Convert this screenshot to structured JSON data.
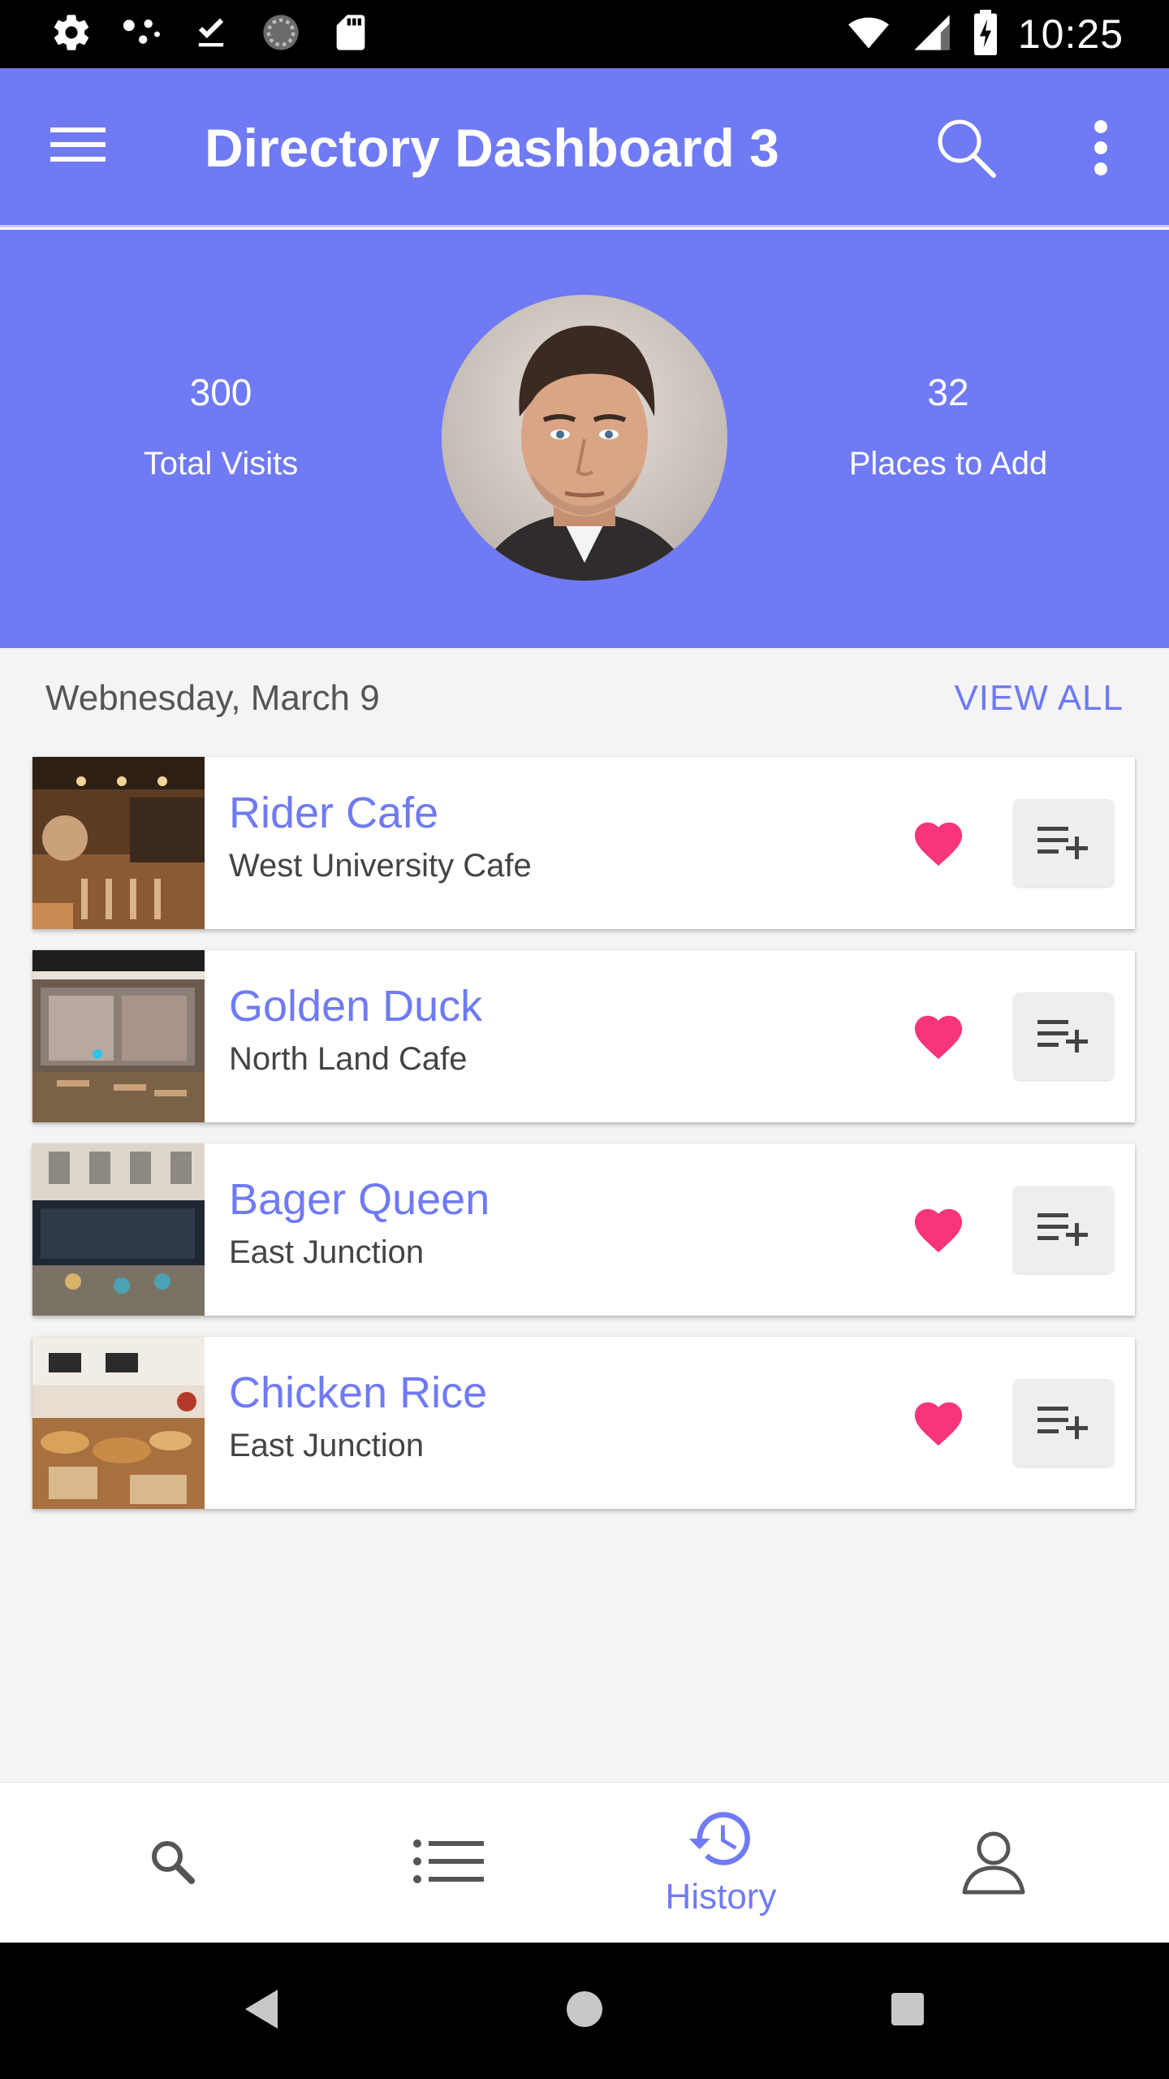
{
  "status_bar": {
    "time": "10:25",
    "icons": [
      "settings-icon",
      "dots-icon",
      "download-done-icon",
      "sync-icon",
      "sd-card-icon",
      "wifi-icon",
      "signal-icon",
      "battery-charging-icon"
    ]
  },
  "app_bar": {
    "title": "Directory Dashboard 3",
    "icons": [
      "menu-icon",
      "search-icon",
      "more-vert-icon"
    ]
  },
  "profile": {
    "total_visits_value": "300",
    "total_visits_label": "Total Visits",
    "places_to_add_value": "32",
    "places_to_add_label": "Places to Add"
  },
  "list_header": {
    "date": "Webnesday, March 9",
    "view_all": "VIEW ALL"
  },
  "places": [
    {
      "name": "Rider Cafe",
      "subtitle": "West University Cafe"
    },
    {
      "name": "Golden Duck",
      "subtitle": "North Land Cafe"
    },
    {
      "name": "Bager Queen",
      "subtitle": "East Junction"
    },
    {
      "name": "Chicken Rice",
      "subtitle": "East Junction"
    }
  ],
  "bottom_nav": {
    "items": [
      {
        "icon": "search-icon",
        "label": ""
      },
      {
        "icon": "list-icon",
        "label": ""
      },
      {
        "icon": "history-icon",
        "label": "History"
      },
      {
        "icon": "person-icon",
        "label": ""
      }
    ],
    "active_index": 2
  },
  "colors": {
    "primary": "#6f7af4",
    "heart": "#f7347c",
    "background": "#f4f4f4"
  }
}
